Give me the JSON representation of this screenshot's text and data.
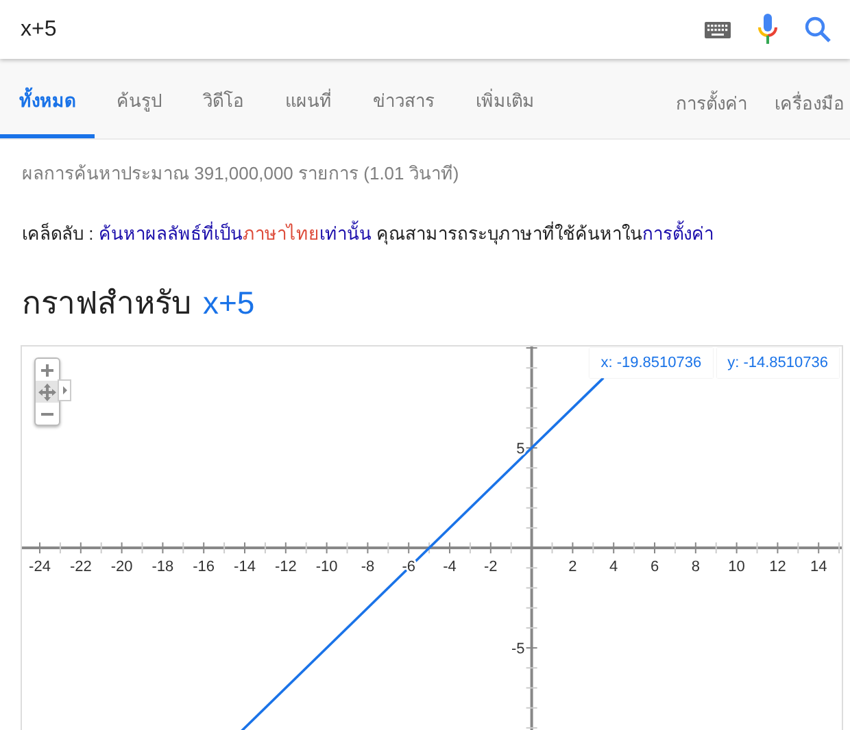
{
  "search": {
    "value": "x+5"
  },
  "tabs": [
    {
      "label": "ทั้งหมด",
      "selected": true
    },
    {
      "label": "ค้นรูป",
      "selected": false
    },
    {
      "label": "วิดีโอ",
      "selected": false
    },
    {
      "label": "แผนที่",
      "selected": false
    },
    {
      "label": "ข่าวสาร",
      "selected": false
    },
    {
      "label": "เพิ่มเติม",
      "selected": false
    }
  ],
  "tools": [
    "การตั้งค่า",
    "เครื่องมือ"
  ],
  "result_stats": "ผลการค้นหาประมาณ 391,000,000 รายการ (1.01 วินาที)",
  "tip": [
    {
      "kind": "text",
      "text": "เคล็ดลับ : "
    },
    {
      "kind": "link",
      "text": "ค้นหาผลลัพธ์ที่เป็น"
    },
    {
      "kind": "highlight",
      "text": "ภาษาไทย"
    },
    {
      "kind": "link",
      "text": "เท่านั้น"
    },
    {
      "kind": "text",
      "text": " คุณสามารถระบุภาษาที่ใช้ค้นหาใน"
    },
    {
      "kind": "link",
      "text": "การตั้งค่า"
    }
  ],
  "graph": {
    "title": "กราฟสำหรับ",
    "expression": "x+5",
    "readout": {
      "x": "x: -19.8510736",
      "y": "y: -14.8510736"
    },
    "chart_data": {
      "type": "line",
      "xlim": [
        -24.87,
        15.13
      ],
      "ylim": [
        -10.27,
        10.07
      ],
      "xticks": [
        -24,
        -22,
        -20,
        -18,
        -16,
        -14,
        -12,
        -10,
        -8,
        -6,
        -4,
        -2,
        2,
        4,
        6,
        8,
        10,
        12,
        14
      ],
      "yticks": [
        -5,
        5
      ],
      "x": [
        -15,
        3.5
      ],
      "series": [
        {
          "color": "#1a73e8",
          "values": [
            -10,
            8.5
          ]
        }
      ]
    }
  }
}
